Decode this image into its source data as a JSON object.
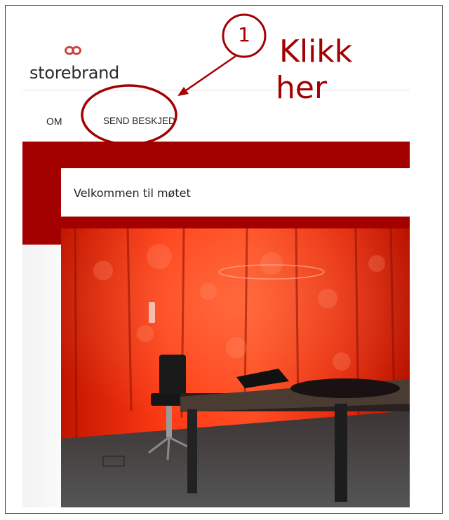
{
  "brand": {
    "name": "storebrand",
    "accent": "#a30000"
  },
  "nav": {
    "items": [
      "OM",
      "SEND BESKJED"
    ]
  },
  "welcome": {
    "text": "Velkommen til møtet"
  },
  "annotation": {
    "step_number": "1",
    "line1": "Klikk",
    "line2": "her",
    "color": "#a30000"
  },
  "photo": {
    "icon": "meeting-room-photo"
  }
}
